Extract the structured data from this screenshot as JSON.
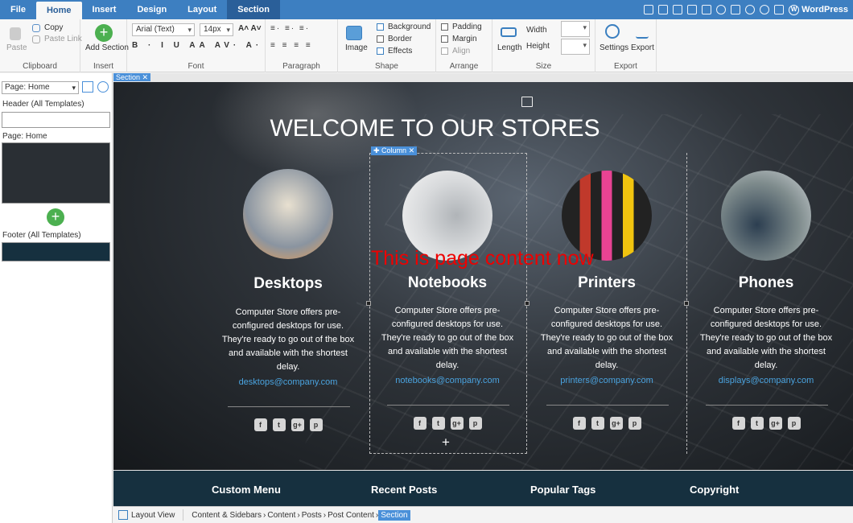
{
  "menu": {
    "tabs": [
      "File",
      "Home",
      "Insert",
      "Design",
      "Layout",
      "Section"
    ],
    "wordpress_label": "WordPress"
  },
  "ribbon": {
    "clipboard": {
      "paste": "Paste",
      "copy": "Copy",
      "paste_link": "Paste Link",
      "label": "Clipboard"
    },
    "insert": {
      "add_section": "Add Section",
      "label": "Insert"
    },
    "font": {
      "family": "Arial (Text)",
      "size": "14px",
      "label": "Font"
    },
    "paragraph": {
      "label": "Paragraph"
    },
    "shape": {
      "image": "Image",
      "background": "Background",
      "border": "Border",
      "effects": "Effects",
      "label": "Shape"
    },
    "arrange": {
      "padding": "Padding",
      "margin": "Margin",
      "align": "Align",
      "label": "Arrange"
    },
    "size": {
      "length": "Length",
      "width": "Width",
      "height": "Height",
      "label": "Size"
    },
    "export": {
      "settings": "Settings",
      "export": "Export",
      "label": "Export"
    }
  },
  "sidebar": {
    "page_select": "Page: Home",
    "header_label": "Header (All Templates)",
    "page_label": "Page: Home",
    "footer_label": "Footer (All Templates)"
  },
  "canvas": {
    "section_tag": "Section",
    "column_tag": "Column",
    "title": "WELCOME TO OUR STORES",
    "overlay": "This is page content now",
    "columns": [
      {
        "name": "Desktops",
        "desc": "Computer Store offers pre-configured desktops for use. They're ready to go out of the box and available with the shortest delay.",
        "email": "desktops@company.com"
      },
      {
        "name": "Notebooks",
        "desc": "Computer Store offers pre-configured desktops for use. They're ready to go out of the box and available with the shortest delay.",
        "email": "notebooks@company.com"
      },
      {
        "name": "Printers",
        "desc": "Computer Store offers pre-configured desktops for use. They're ready to go out of the box and available with the shortest delay.",
        "email": "printers@company.com"
      },
      {
        "name": "Phones",
        "desc": "Computer Store offers pre-configured desktops for use. They're ready to go out of the box and available with the shortest delay.",
        "email": "displays@company.com"
      }
    ],
    "footer": [
      "Custom Menu",
      "Recent Posts",
      "Popular Tags",
      "Copyright"
    ]
  },
  "statusbar": {
    "layout_view": "Layout View",
    "crumbs": [
      "Content & Sidebars",
      "Content",
      "Posts",
      "Post Content",
      "Section"
    ]
  },
  "colors": {
    "accent": "#3d7fc1",
    "link": "#4aa3df",
    "overlay": "#e00000",
    "footer": "#16303f"
  }
}
